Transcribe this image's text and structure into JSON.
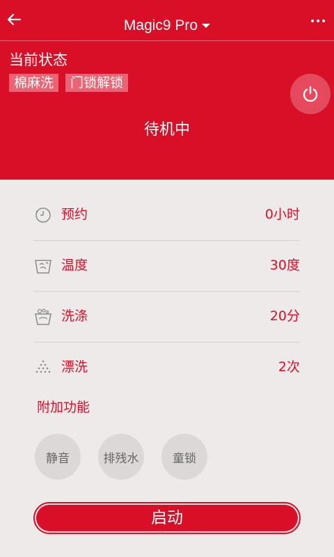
{
  "header": {
    "device_name": "Magic9 Pro",
    "status_label": "当前状态",
    "tags": [
      "棉麻洗",
      "门锁解锁"
    ],
    "state_text": "待机中",
    "power_icon": "power-icon",
    "back_icon": "arrow-left-icon",
    "more_icon": "more-dots-icon"
  },
  "settings": [
    {
      "icon": "clock-icon",
      "label": "预约",
      "value": "0小时"
    },
    {
      "icon": "temperature-icon",
      "label": "温度",
      "value": "30度"
    },
    {
      "icon": "wash-tub-icon",
      "label": "洗涤",
      "value": "20分"
    },
    {
      "icon": "rinse-drops-icon",
      "label": "漂洗",
      "value": "2次"
    }
  ],
  "extra": {
    "title": "附加功能",
    "buttons": [
      "静音",
      "排残水",
      "童锁"
    ]
  },
  "start_button": {
    "label": "启动"
  },
  "colors": {
    "brand_red": "#d90f28",
    "background": "#eeeaea",
    "circle_button_bg": "#dcd8d8"
  }
}
